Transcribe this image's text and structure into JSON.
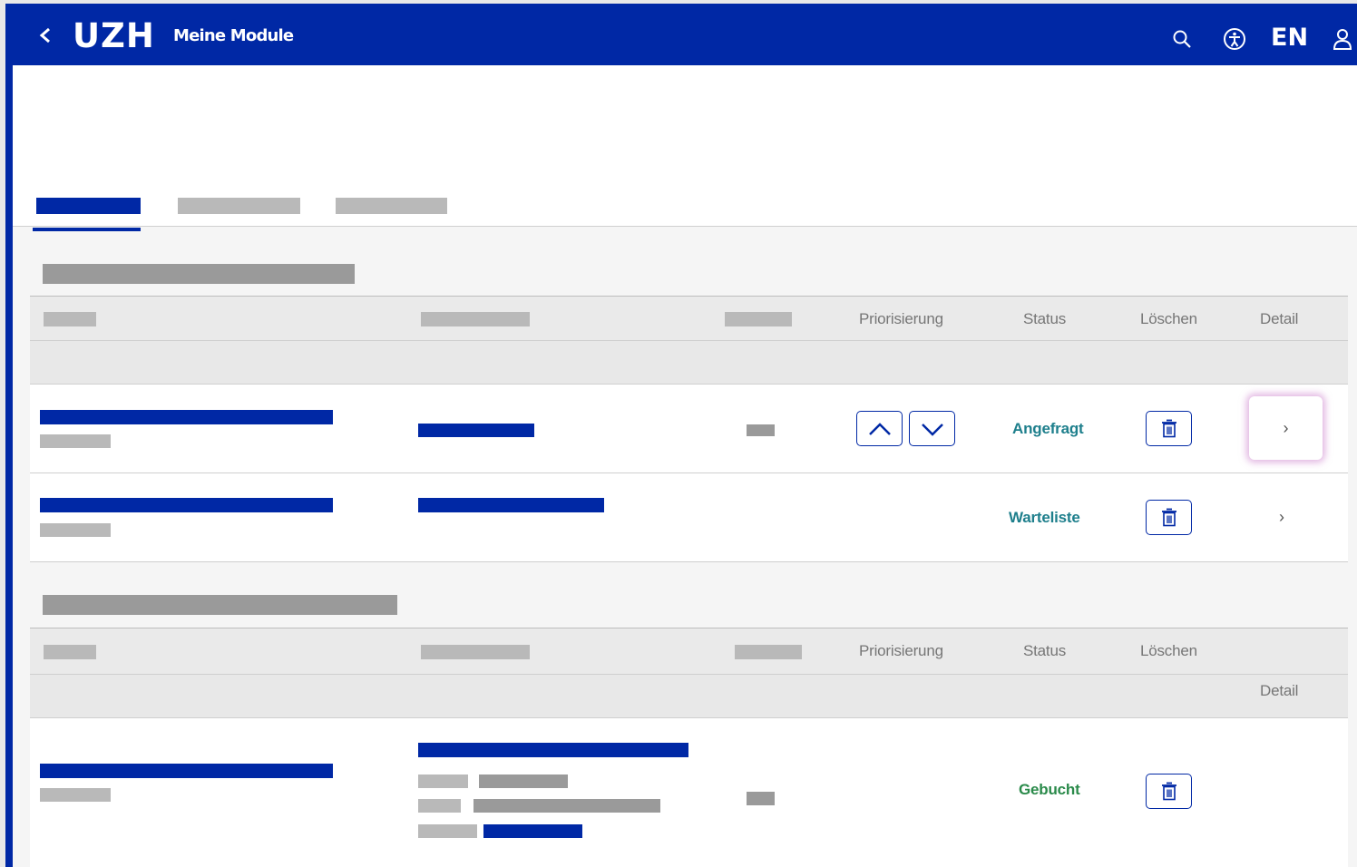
{
  "header": {
    "title": "Meine Module",
    "logo": "UZH",
    "language": "EN",
    "icons": [
      "back-icon",
      "search-icon",
      "accessibility-icon",
      "user-icon"
    ]
  },
  "colors": {
    "brand": "#0028a5",
    "status_requested": "#1e7f8c",
    "status_waitlist": "#1e7f8c",
    "status_booked": "#2a8a4a"
  },
  "table1": {
    "columns": {
      "prioritization": "Priorisierung",
      "status": "Status",
      "delete": "Löschen",
      "detail": "Detail"
    },
    "rows": [
      {
        "status": "Angefragt",
        "has_priority_controls": true,
        "detail_icon": "chevron-right-icon"
      },
      {
        "status": "Warteliste",
        "has_priority_controls": false,
        "detail_icon": "chevron-right-icon"
      }
    ]
  },
  "table2": {
    "columns": {
      "prioritization": "Priorisierung",
      "status": "Status",
      "delete": "Löschen",
      "detail": "Detail"
    },
    "rows": [
      {
        "status": "Gebucht"
      }
    ]
  },
  "glyphs": {
    "back": "‹",
    "detail": "›"
  }
}
